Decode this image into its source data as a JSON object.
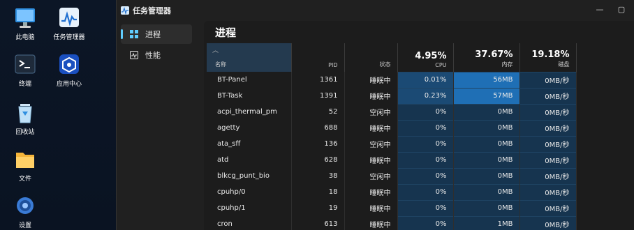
{
  "desktop": {
    "icons": [
      {
        "label": "此电脑",
        "icon": "monitor-icon"
      },
      {
        "label": "任务管理器",
        "icon": "task-manager-icon"
      },
      {
        "label": "终端",
        "icon": "terminal-icon"
      },
      {
        "label": "应用中心",
        "icon": "app-center-icon"
      },
      {
        "label": "回收站",
        "icon": "recycle-bin-icon"
      },
      {
        "label": "文件",
        "icon": "folder-icon"
      },
      {
        "label": "设置",
        "icon": "settings-gear-icon"
      }
    ]
  },
  "window": {
    "title": "任务管理器",
    "controls": {
      "minimize": "—",
      "maximize": "▢"
    }
  },
  "sidebar": {
    "items": [
      {
        "label": "进程",
        "icon": "grid-icon",
        "active": true
      },
      {
        "label": "性能",
        "icon": "activity-chart-icon",
        "active": false
      }
    ]
  },
  "main": {
    "title": "进程",
    "columns": {
      "name": "名称",
      "pid": "PID",
      "status": "状态",
      "cpu": {
        "label": "CPU",
        "value": "4.95%"
      },
      "memory": {
        "label": "内存",
        "value": "37.67%"
      },
      "disk": {
        "label": "磁盘",
        "value": "19.18%"
      }
    },
    "rows": [
      {
        "name": "BT-Panel",
        "pid": "1361",
        "status": "睡眠中",
        "cpu": "0.01%",
        "mem": "56MB",
        "disk": "0MB/秒"
      },
      {
        "name": "BT-Task",
        "pid": "1391",
        "status": "睡眠中",
        "cpu": "0.23%",
        "mem": "57MB",
        "disk": "0MB/秒"
      },
      {
        "name": "acpi_thermal_pm",
        "pid": "52",
        "status": "空闲中",
        "cpu": "0%",
        "mem": "0MB",
        "disk": "0MB/秒"
      },
      {
        "name": "agetty",
        "pid": "688",
        "status": "睡眠中",
        "cpu": "0%",
        "mem": "0MB",
        "disk": "0MB/秒"
      },
      {
        "name": "ata_sff",
        "pid": "136",
        "status": "空闲中",
        "cpu": "0%",
        "mem": "0MB",
        "disk": "0MB/秒"
      },
      {
        "name": "atd",
        "pid": "628",
        "status": "睡眠中",
        "cpu": "0%",
        "mem": "0MB",
        "disk": "0MB/秒"
      },
      {
        "name": "blkcg_punt_bio",
        "pid": "38",
        "status": "空闲中",
        "cpu": "0%",
        "mem": "0MB",
        "disk": "0MB/秒"
      },
      {
        "name": "cpuhp/0",
        "pid": "18",
        "status": "睡眠中",
        "cpu": "0%",
        "mem": "0MB",
        "disk": "0MB/秒"
      },
      {
        "name": "cpuhp/1",
        "pid": "19",
        "status": "睡眠中",
        "cpu": "0%",
        "mem": "0MB",
        "disk": "0MB/秒"
      },
      {
        "name": "cron",
        "pid": "613",
        "status": "睡眠中",
        "cpu": "0%",
        "mem": "1MB",
        "disk": "0MB/秒"
      }
    ]
  }
}
